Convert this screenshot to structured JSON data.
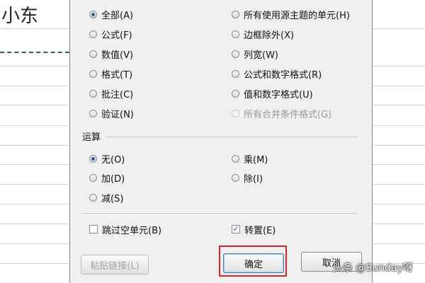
{
  "sheet": {
    "cell_text": "小东"
  },
  "paste_options": [
    {
      "label": "全部(A)",
      "checked": true,
      "disabled": false
    },
    {
      "label": "公式(F)",
      "checked": false,
      "disabled": false
    },
    {
      "label": "数值(V)",
      "checked": false,
      "disabled": false
    },
    {
      "label": "格式(T)",
      "checked": false,
      "disabled": false
    },
    {
      "label": "批注(C)",
      "checked": false,
      "disabled": false
    },
    {
      "label": "验证(N)",
      "checked": false,
      "disabled": false
    },
    {
      "label": "所有使用源主题的单元(H)",
      "checked": false,
      "disabled": false
    },
    {
      "label": "边框除外(X)",
      "checked": false,
      "disabled": false
    },
    {
      "label": "列宽(W)",
      "checked": false,
      "disabled": false
    },
    {
      "label": "公式和数字格式(R)",
      "checked": false,
      "disabled": false
    },
    {
      "label": "值和数字格式(U)",
      "checked": false,
      "disabled": false
    },
    {
      "label": "所有合并条件格式(G)",
      "checked": false,
      "disabled": true
    }
  ],
  "operation": {
    "label": "运算",
    "options": [
      {
        "label": "无(O)",
        "checked": true
      },
      {
        "label": "加(D)",
        "checked": false
      },
      {
        "label": "减(S)",
        "checked": false
      },
      {
        "label": "乘(M)",
        "checked": false
      },
      {
        "label": "除(I)",
        "checked": false
      }
    ]
  },
  "skip_blanks": {
    "label": "跳过空单元(B)",
    "checked": false
  },
  "transpose": {
    "label": "转置(E)",
    "checked": true
  },
  "buttons": {
    "paste_link": "粘贴链接(L)",
    "ok": "确定",
    "cancel": "取消"
  },
  "watermark": "头条 @Sunday呀"
}
